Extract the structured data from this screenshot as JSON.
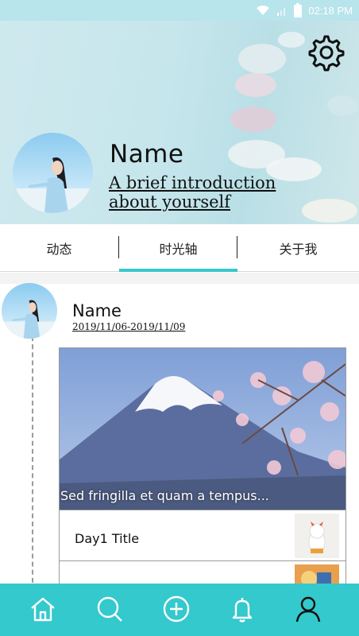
{
  "statusbar": {
    "time": "02:18 PM"
  },
  "profile": {
    "name": "Name",
    "intro": "A brief introduction about yourself"
  },
  "tabs": [
    {
      "label": "动态"
    },
    {
      "label": "时光轴",
      "active": true
    },
    {
      "label": "关于我"
    }
  ],
  "post": {
    "name": "Name",
    "date_range": "2019/11/06-2019/11/09",
    "caption": "Sed fringilla et quam a tempus...",
    "days": [
      {
        "title": "Day1 Title"
      }
    ]
  },
  "colors": {
    "accent": "#36c8cc",
    "nav_background": "#34c9cc",
    "header_background": "#c6e6ec"
  },
  "bottom_nav": {
    "items": [
      "home-icon",
      "search-icon",
      "add-icon",
      "bell-icon",
      "profile-icon"
    ]
  }
}
